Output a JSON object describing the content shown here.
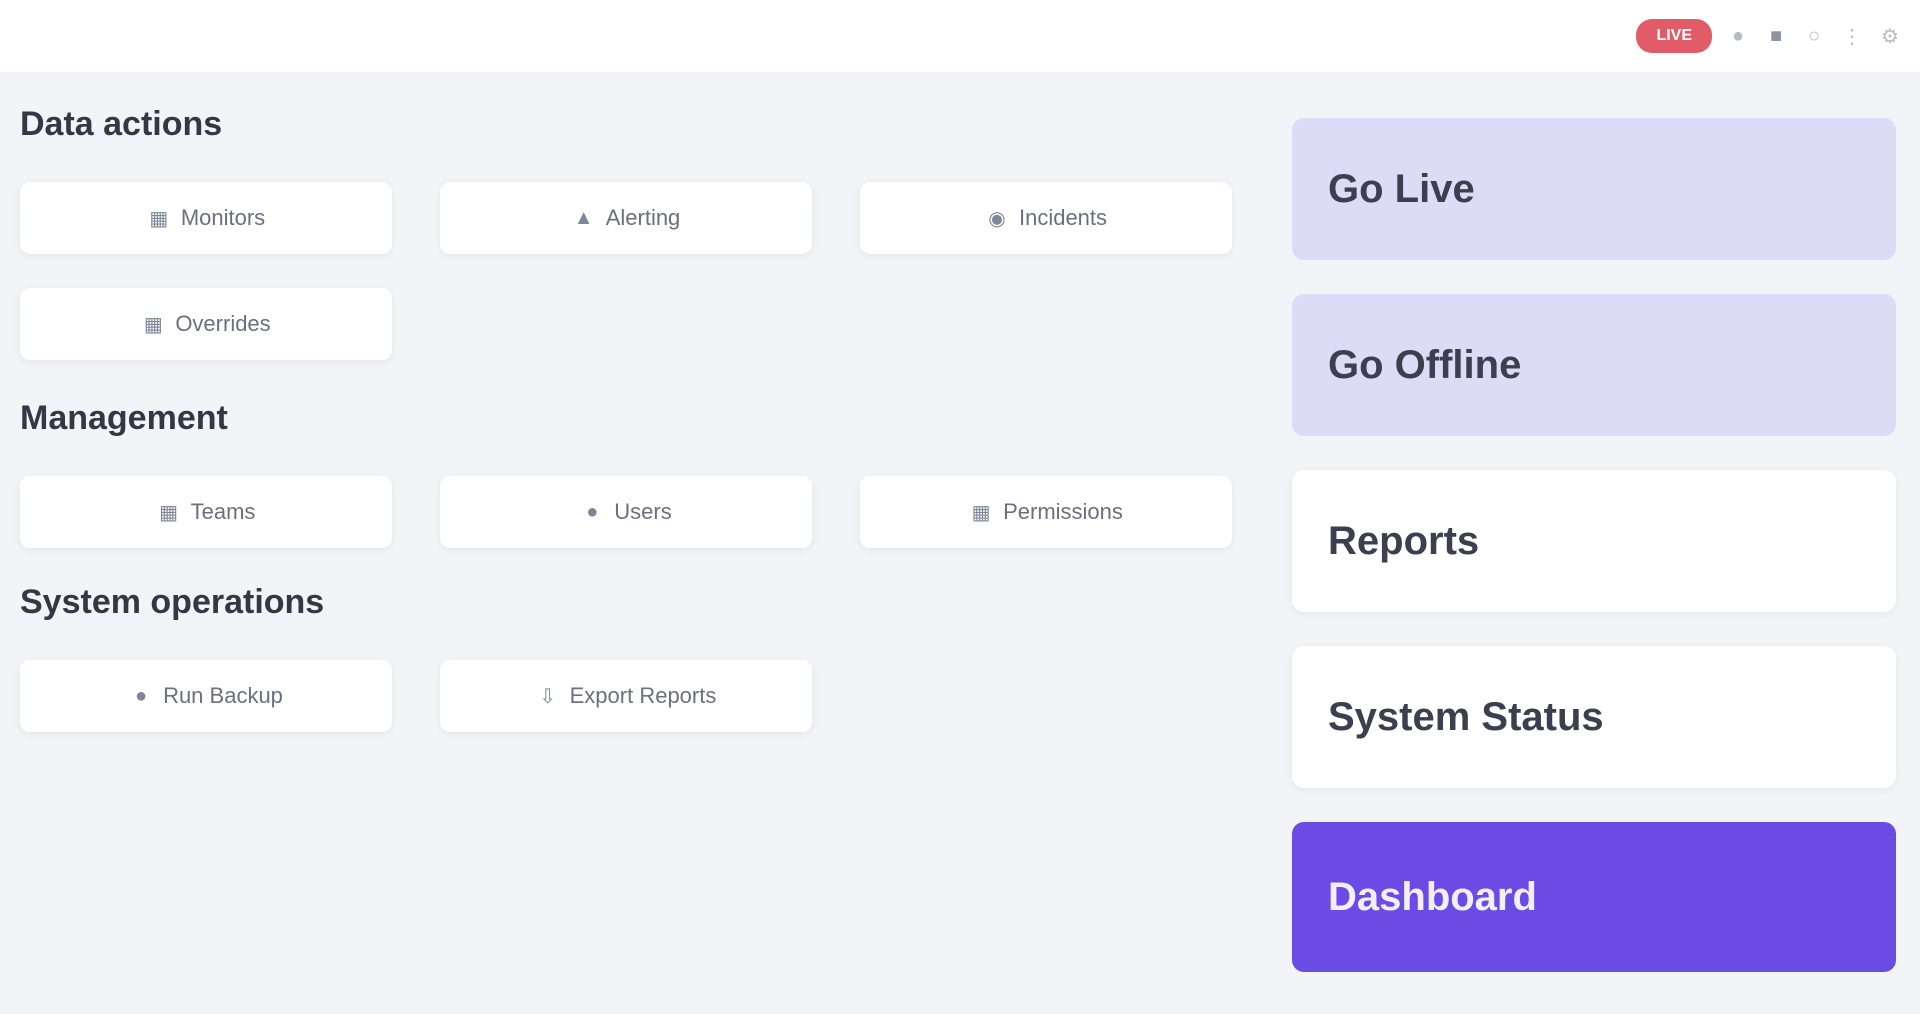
{
  "topbar": {
    "live_badge": "LIVE",
    "icons": [
      "mic-icon",
      "camera-icon",
      "bell-icon",
      "more-icon",
      "settings-icon"
    ]
  },
  "sections": [
    {
      "title": "Data actions",
      "buttons": [
        {
          "label": "Monitors",
          "icon": "chart-icon"
        },
        {
          "label": "Alerting",
          "icon": "alert-icon"
        },
        {
          "label": "Incidents",
          "icon": "incident-icon"
        },
        {
          "label": "Overrides",
          "icon": "override-icon"
        }
      ]
    },
    {
      "title": "Management",
      "buttons": [
        {
          "label": "Teams",
          "icon": "team-icon"
        },
        {
          "label": "Users",
          "icon": "user-icon"
        },
        {
          "label": "Permissions",
          "icon": "lock-icon"
        }
      ]
    },
    {
      "title": "System operations",
      "buttons": [
        {
          "label": "Run Backup",
          "icon": "backup-icon"
        },
        {
          "label": "Export Reports",
          "icon": "export-icon"
        }
      ]
    }
  ],
  "side_actions": [
    {
      "label": "Go Live",
      "style": "lavender"
    },
    {
      "label": "Go Offline",
      "style": "lavender"
    },
    {
      "label": "Reports",
      "style": "white"
    },
    {
      "label": "System Status",
      "style": "white"
    },
    {
      "label": "Dashboard",
      "style": "primary"
    }
  ],
  "colors": {
    "accent": "#6a4ce4",
    "lavender": "#dedbf7",
    "live": "#e15c66",
    "background": "#f2f4f7"
  }
}
